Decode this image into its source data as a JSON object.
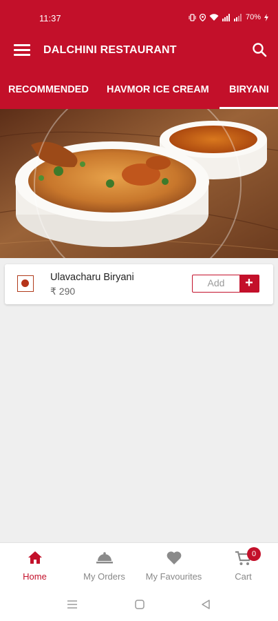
{
  "status_bar": {
    "time": "11:37",
    "battery": "70%"
  },
  "app_bar": {
    "title": "DALCHINI RESTAURANT"
  },
  "tabs": [
    {
      "label": "RECOMMENDED",
      "active": false
    },
    {
      "label": "HAVMOR ICE CREAM",
      "active": false
    },
    {
      "label": "BIRYANI",
      "active": true
    }
  ],
  "banner": {
    "icon": "biryani-food-photo"
  },
  "items": [
    {
      "name": "Ulavacharu Biryani",
      "price": "₹ 290",
      "add_label": "Add",
      "plus": "+"
    }
  ],
  "bottom_nav": {
    "home": "Home",
    "orders": "My Orders",
    "favourites": "My Favourites",
    "cart": "Cart",
    "cart_count": "0"
  },
  "colors": {
    "brand": "#c3102a",
    "background": "#efefef",
    "inactive": "#888888"
  }
}
